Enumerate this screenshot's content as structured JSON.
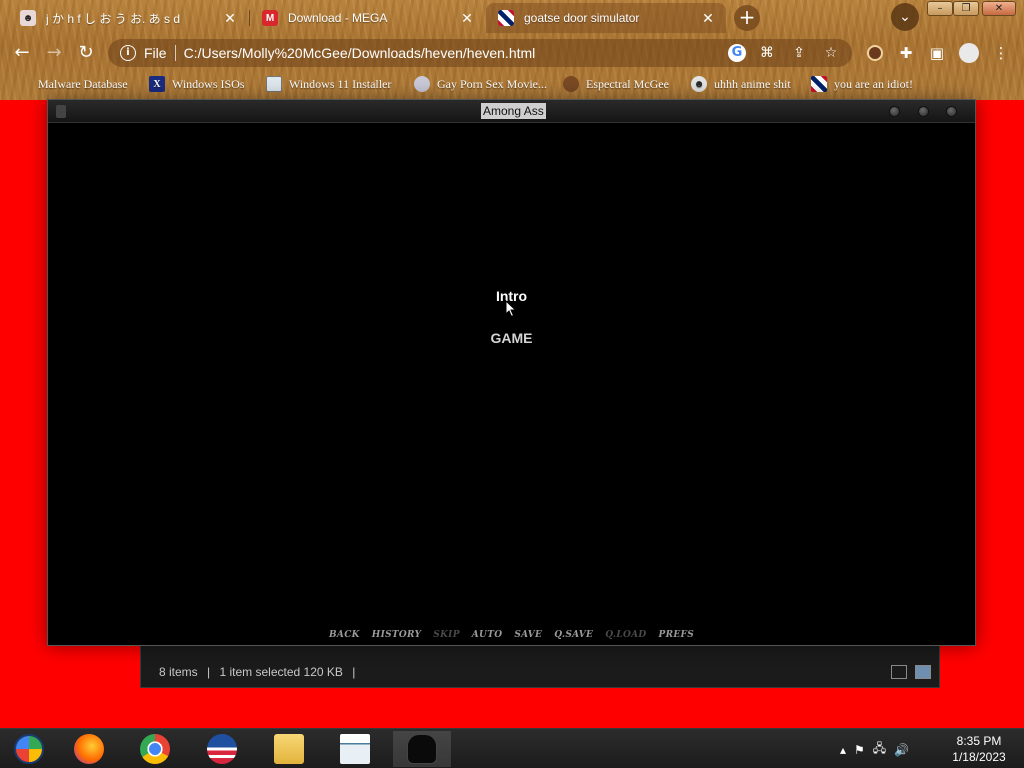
{
  "browser": {
    "tabs": [
      {
        "title": "j か h f し お う お. あ s d",
        "active": false
      },
      {
        "title": "Download - MEGA",
        "active": false
      },
      {
        "title": "goatse door simulator",
        "active": true
      }
    ],
    "new_tab_symbol": "+",
    "tab_search_symbol": "⌄",
    "window_controls": {
      "minimize": "–",
      "restore": "❐",
      "close": "✕"
    },
    "omnibox": {
      "scheme": "File",
      "url": "C:/Users/Molly%20McGee/Downloads/heven/heven.html"
    },
    "bookmarks": [
      {
        "label": "Malware Database",
        "icon": "none"
      },
      {
        "label": "Windows ISOs",
        "icon": "x-logo-icon"
      },
      {
        "label": "Windows 11 Installer",
        "icon": "image-icon"
      },
      {
        "label": "Gay Porn Sex Movie...",
        "icon": "disc-icon"
      },
      {
        "label": "Espectral McGee",
        "icon": "avatar-icon"
      },
      {
        "label": "uhhh anime shit",
        "icon": "anime-icon"
      },
      {
        "label": "you are an idiot!",
        "icon": "flag-icon"
      }
    ]
  },
  "game_window": {
    "title": "Among Ass",
    "menu": {
      "intro": "Intro",
      "game": "GAME"
    },
    "quick_menu": [
      {
        "label": "BACK",
        "enabled": true
      },
      {
        "label": "HISTORY",
        "enabled": true
      },
      {
        "label": "SKIP",
        "enabled": false
      },
      {
        "label": "AUTO",
        "enabled": true
      },
      {
        "label": "SAVE",
        "enabled": true
      },
      {
        "label": "Q.SAVE",
        "enabled": true
      },
      {
        "label": "Q.LOAD",
        "enabled": false
      },
      {
        "label": "PREFS",
        "enabled": true
      }
    ]
  },
  "explorer": {
    "item_count": "8 items",
    "selection": "1 item selected  120 KB"
  },
  "taskbar": {
    "apps": [
      "start-orb",
      "firefox",
      "chrome",
      "obama",
      "file-explorer",
      "notepad",
      "game"
    ],
    "clock": {
      "time": "8:35 PM",
      "date": "1/18/2023"
    }
  },
  "colors": {
    "desktop": "#ff0000",
    "chrome_wood": "#b07c3a",
    "game_bg": "#000000"
  }
}
